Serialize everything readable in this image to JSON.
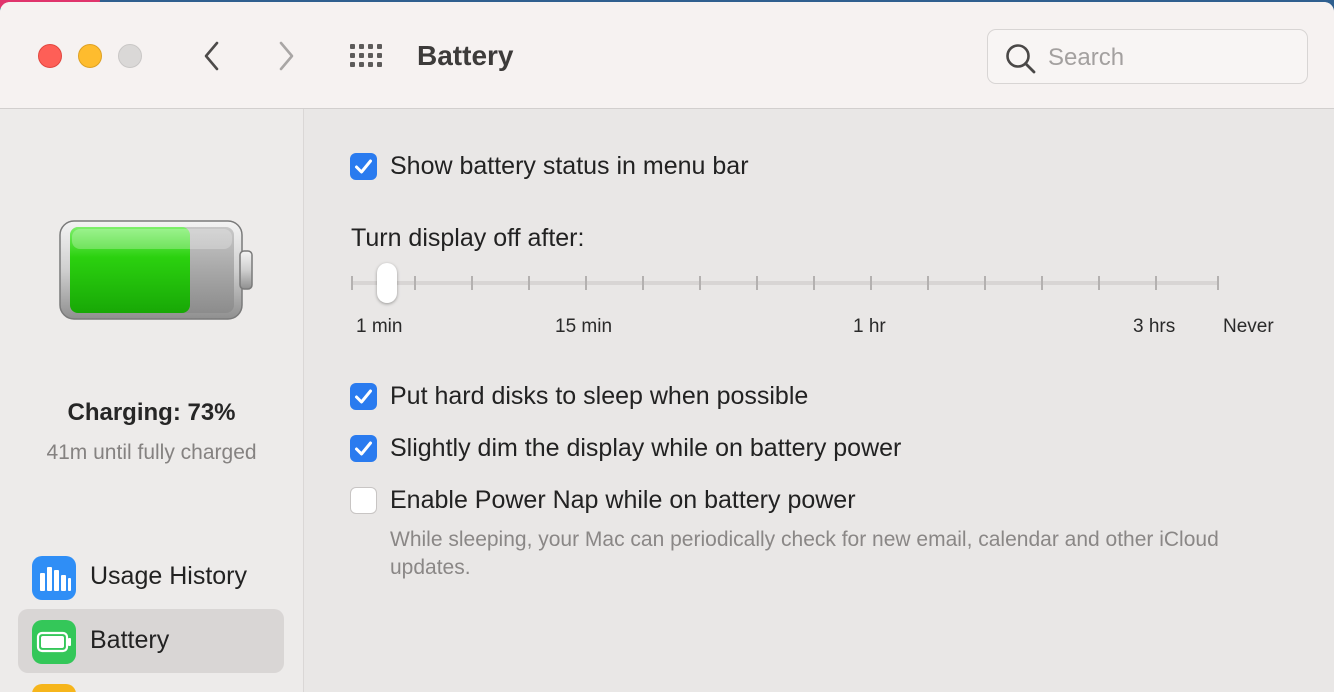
{
  "window": {
    "title": "Battery"
  },
  "toolbar": {
    "back_icon": "chevron-left-icon",
    "forward_icon": "chevron-right-icon",
    "show_all_icon": "grid-icon"
  },
  "search": {
    "placeholder": "Search",
    "value": ""
  },
  "sidebar": {
    "charge_status": "Charging: 73%",
    "charge_level": 0.73,
    "time_remaining": "41m until fully charged",
    "items": [
      {
        "label": "Usage History",
        "icon": "bar-chart-icon",
        "color": "#2f8ef6",
        "active": false
      },
      {
        "label": "Battery",
        "icon": "battery-icon",
        "color": "#34c759",
        "active": true
      }
    ]
  },
  "settings": {
    "show_status": {
      "label": "Show battery status in menu bar",
      "checked": true
    },
    "display_off": {
      "label": "Turn display off after:",
      "tick_labels": [
        "1 min",
        "15 min",
        "1 hr",
        "3 hrs",
        "Never"
      ],
      "selected": "1 min"
    },
    "hard_disks": {
      "label": "Put hard disks to sleep when possible",
      "checked": true
    },
    "dim_display": {
      "label": "Slightly dim the display while on battery power",
      "checked": true
    },
    "power_nap": {
      "label": "Enable Power Nap while on battery power",
      "checked": false,
      "description": "While sleeping, your Mac can periodically check for new email, calendar and other iCloud updates."
    }
  },
  "colors": {
    "accent": "#2a7bef",
    "battery_green": "#2bd10f"
  }
}
